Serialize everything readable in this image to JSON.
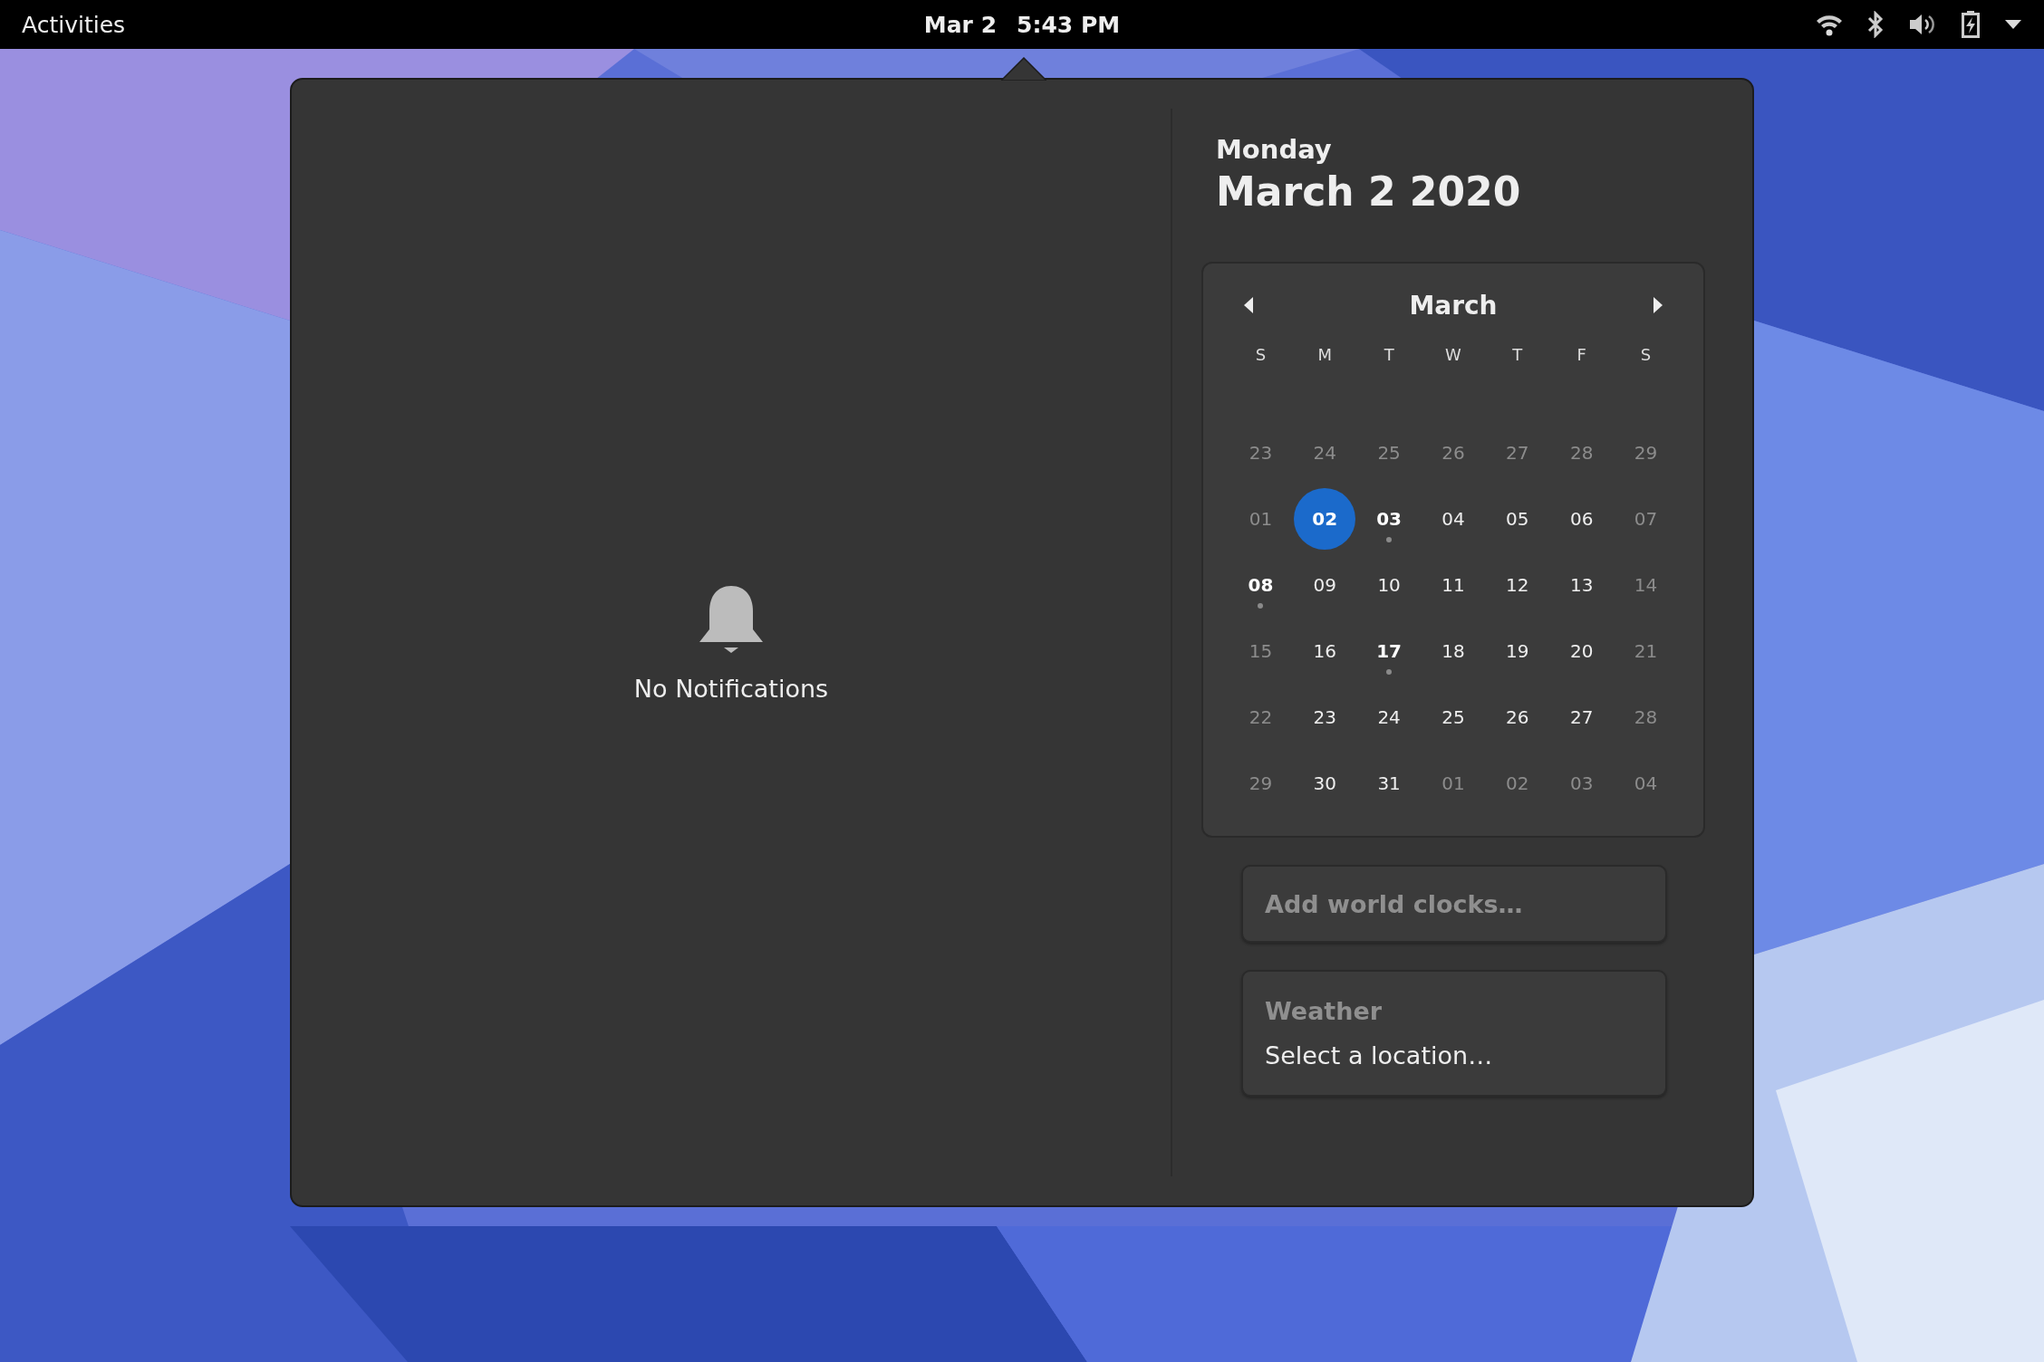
{
  "top_bar": {
    "activities": "Activities",
    "date": "Mar 2",
    "time": "5:43 PM"
  },
  "notifications": {
    "empty_text": "No Notifications"
  },
  "date_header": {
    "weekday": "Monday",
    "date": "March 2 2020"
  },
  "calendar": {
    "month": "March",
    "weekdays": [
      "S",
      "M",
      "T",
      "W",
      "T",
      "F",
      "S"
    ],
    "weeks": [
      [
        {
          "label": "23",
          "dimmed": true,
          "events": false,
          "selected": false
        },
        {
          "label": "24",
          "dimmed": true,
          "events": false,
          "selected": false
        },
        {
          "label": "25",
          "dimmed": true,
          "events": false,
          "selected": false
        },
        {
          "label": "26",
          "dimmed": true,
          "events": false,
          "selected": false
        },
        {
          "label": "27",
          "dimmed": true,
          "events": false,
          "selected": false
        },
        {
          "label": "28",
          "dimmed": true,
          "events": false,
          "selected": false
        },
        {
          "label": "29",
          "dimmed": true,
          "events": false,
          "selected": false
        }
      ],
      [
        {
          "label": "01",
          "dimmed": true,
          "events": false,
          "selected": false
        },
        {
          "label": "02",
          "dimmed": false,
          "events": false,
          "selected": true
        },
        {
          "label": "03",
          "dimmed": false,
          "events": true,
          "selected": false
        },
        {
          "label": "04",
          "dimmed": false,
          "events": false,
          "selected": false
        },
        {
          "label": "05",
          "dimmed": false,
          "events": false,
          "selected": false
        },
        {
          "label": "06",
          "dimmed": false,
          "events": false,
          "selected": false
        },
        {
          "label": "07",
          "dimmed": true,
          "events": false,
          "selected": false
        }
      ],
      [
        {
          "label": "08",
          "dimmed": false,
          "events": true,
          "selected": false
        },
        {
          "label": "09",
          "dimmed": false,
          "events": false,
          "selected": false
        },
        {
          "label": "10",
          "dimmed": false,
          "events": false,
          "selected": false
        },
        {
          "label": "11",
          "dimmed": false,
          "events": false,
          "selected": false
        },
        {
          "label": "12",
          "dimmed": false,
          "events": false,
          "selected": false
        },
        {
          "label": "13",
          "dimmed": false,
          "events": false,
          "selected": false
        },
        {
          "label": "14",
          "dimmed": true,
          "events": false,
          "selected": false
        }
      ],
      [
        {
          "label": "15",
          "dimmed": true,
          "events": false,
          "selected": false
        },
        {
          "label": "16",
          "dimmed": false,
          "events": false,
          "selected": false
        },
        {
          "label": "17",
          "dimmed": false,
          "events": true,
          "selected": false
        },
        {
          "label": "18",
          "dimmed": false,
          "events": false,
          "selected": false
        },
        {
          "label": "19",
          "dimmed": false,
          "events": false,
          "selected": false
        },
        {
          "label": "20",
          "dimmed": false,
          "events": false,
          "selected": false
        },
        {
          "label": "21",
          "dimmed": true,
          "events": false,
          "selected": false
        }
      ],
      [
        {
          "label": "22",
          "dimmed": true,
          "events": false,
          "selected": false
        },
        {
          "label": "23",
          "dimmed": false,
          "events": false,
          "selected": false
        },
        {
          "label": "24",
          "dimmed": false,
          "events": false,
          "selected": false
        },
        {
          "label": "25",
          "dimmed": false,
          "events": false,
          "selected": false
        },
        {
          "label": "26",
          "dimmed": false,
          "events": false,
          "selected": false
        },
        {
          "label": "27",
          "dimmed": false,
          "events": false,
          "selected": false
        },
        {
          "label": "28",
          "dimmed": true,
          "events": false,
          "selected": false
        }
      ],
      [
        {
          "label": "29",
          "dimmed": true,
          "events": false,
          "selected": false
        },
        {
          "label": "30",
          "dimmed": false,
          "events": false,
          "selected": false
        },
        {
          "label": "31",
          "dimmed": false,
          "events": false,
          "selected": false
        },
        {
          "label": "01",
          "dimmed": true,
          "events": false,
          "selected": false
        },
        {
          "label": "02",
          "dimmed": true,
          "events": false,
          "selected": false
        },
        {
          "label": "03",
          "dimmed": true,
          "events": false,
          "selected": false
        },
        {
          "label": "04",
          "dimmed": true,
          "events": false,
          "selected": false
        }
      ]
    ]
  },
  "world_clocks": {
    "label": "Add world clocks…"
  },
  "weather": {
    "title": "Weather",
    "subtitle": "Select a location…"
  }
}
